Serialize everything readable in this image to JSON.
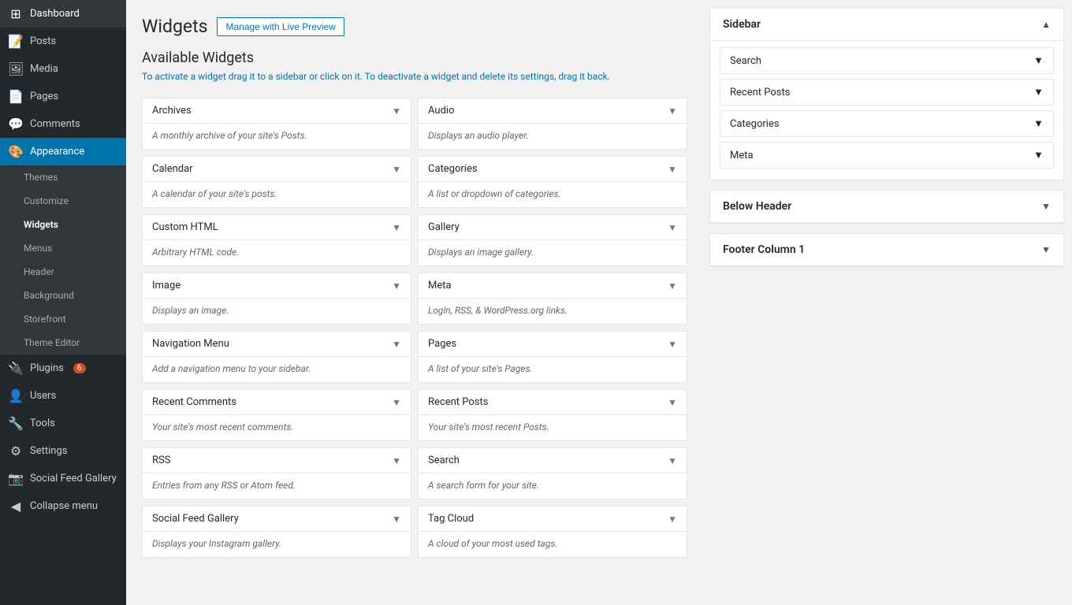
{
  "sidebar": {
    "items": [
      {
        "id": "dashboard",
        "label": "Dashboard",
        "icon": "⊞",
        "active": false
      },
      {
        "id": "posts",
        "label": "Posts",
        "icon": "📝",
        "active": false
      },
      {
        "id": "media",
        "label": "Media",
        "icon": "🖼",
        "active": false
      },
      {
        "id": "pages",
        "label": "Pages",
        "icon": "📄",
        "active": false
      },
      {
        "id": "comments",
        "label": "Comments",
        "icon": "💬",
        "active": false
      },
      {
        "id": "appearance",
        "label": "Appearance",
        "icon": "🎨",
        "active": true
      },
      {
        "id": "plugins",
        "label": "Plugins",
        "icon": "🔌",
        "active": false,
        "badge": "6"
      },
      {
        "id": "users",
        "label": "Users",
        "icon": "👤",
        "active": false
      },
      {
        "id": "tools",
        "label": "Tools",
        "icon": "🔧",
        "active": false
      },
      {
        "id": "settings",
        "label": "Settings",
        "icon": "⚙",
        "active": false
      },
      {
        "id": "social-feed",
        "label": "Social Feed Gallery",
        "icon": "📷",
        "active": false
      },
      {
        "id": "collapse",
        "label": "Collapse menu",
        "icon": "◀",
        "active": false
      }
    ],
    "appearance_sub": [
      {
        "id": "themes",
        "label": "Themes",
        "active": false
      },
      {
        "id": "customize",
        "label": "Customize",
        "active": false
      },
      {
        "id": "widgets",
        "label": "Widgets",
        "active": true
      },
      {
        "id": "menus",
        "label": "Menus",
        "active": false
      },
      {
        "id": "header",
        "label": "Header",
        "active": false
      },
      {
        "id": "background",
        "label": "Background",
        "active": false
      },
      {
        "id": "storefront",
        "label": "Storefront",
        "active": false
      },
      {
        "id": "theme-editor",
        "label": "Theme Editor",
        "active": false
      }
    ]
  },
  "header": {
    "page_title": "Widgets",
    "manage_btn_label": "Manage with Live Preview"
  },
  "available_widgets": {
    "section_title": "Available Widgets",
    "section_desc": "To activate a widget drag it to a sidebar or click on it. To deactivate a widget and delete its settings, drag it back.",
    "widgets": [
      {
        "id": "archives",
        "name": "Archives",
        "desc": "A monthly archive of your site's Posts."
      },
      {
        "id": "audio",
        "name": "Audio",
        "desc": "Displays an audio player."
      },
      {
        "id": "calendar",
        "name": "Calendar",
        "desc": "A calendar of your site's posts."
      },
      {
        "id": "categories",
        "name": "Categories",
        "desc": "A list or dropdown of categories."
      },
      {
        "id": "custom-html",
        "name": "Custom HTML",
        "desc": "Arbitrary HTML code."
      },
      {
        "id": "gallery",
        "name": "Gallery",
        "desc": "Displays an image gallery."
      },
      {
        "id": "image",
        "name": "Image",
        "desc": "Displays an image."
      },
      {
        "id": "meta",
        "name": "Meta",
        "desc": "Login, RSS, & WordPress.org links."
      },
      {
        "id": "navigation-menu",
        "name": "Navigation Menu",
        "desc": "Add a navigation menu to your sidebar."
      },
      {
        "id": "pages",
        "name": "Pages",
        "desc": "A list of your site's Pages."
      },
      {
        "id": "recent-comments",
        "name": "Recent Comments",
        "desc": "Your site's most recent comments."
      },
      {
        "id": "recent-posts",
        "name": "Recent Posts",
        "desc": "Your site's most recent Posts."
      },
      {
        "id": "rss",
        "name": "RSS",
        "desc": "Entries from any RSS or Atom feed."
      },
      {
        "id": "search",
        "name": "Search",
        "desc": "A search form for your site."
      },
      {
        "id": "social-feed-gallery",
        "name": "Social Feed Gallery",
        "desc": "Displays your Instagram gallery."
      },
      {
        "id": "tag-cloud",
        "name": "Tag Cloud",
        "desc": "A cloud of your most used tags."
      }
    ]
  },
  "right_panel": {
    "sidebar_area": {
      "title": "Sidebar",
      "widgets": [
        {
          "id": "search",
          "name": "Search"
        },
        {
          "id": "recent-posts",
          "name": "Recent Posts"
        },
        {
          "id": "categories",
          "name": "Categories"
        },
        {
          "id": "meta",
          "name": "Meta"
        }
      ]
    },
    "below_header": {
      "title": "Below Header"
    },
    "footer_col1": {
      "title": "Footer Column 1"
    }
  }
}
